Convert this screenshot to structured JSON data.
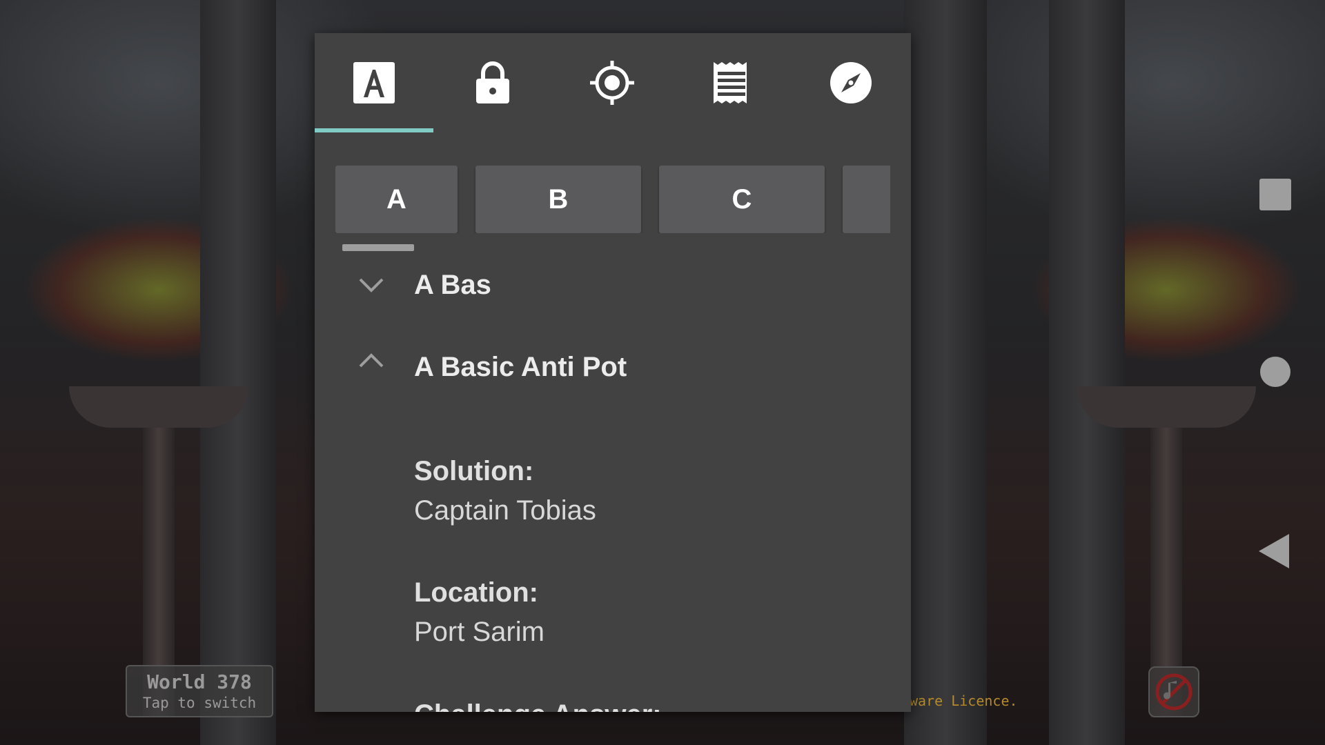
{
  "background": {
    "world_label": "World 378",
    "world_hint": "Tap to switch",
    "licence_text": "ware Licence."
  },
  "tabs": [
    {
      "icon": "letter-a-icon"
    },
    {
      "icon": "lock-icon"
    },
    {
      "icon": "crosshair-icon"
    },
    {
      "icon": "receipt-icon"
    },
    {
      "icon": "compass-icon"
    }
  ],
  "active_tab": 0,
  "accent_color": "#80cbc4",
  "letters": [
    "A",
    "B",
    "C"
  ],
  "entries": [
    {
      "title": "A Bas",
      "expanded": false
    },
    {
      "title": "A Basic Anti Pot",
      "expanded": true,
      "fields": [
        {
          "label": "Solution:",
          "value": "Captain Tobias"
        },
        {
          "label": "Location:",
          "value": "Port Sarim"
        },
        {
          "label": "Challenge Answer:",
          "value": ""
        }
      ]
    }
  ]
}
